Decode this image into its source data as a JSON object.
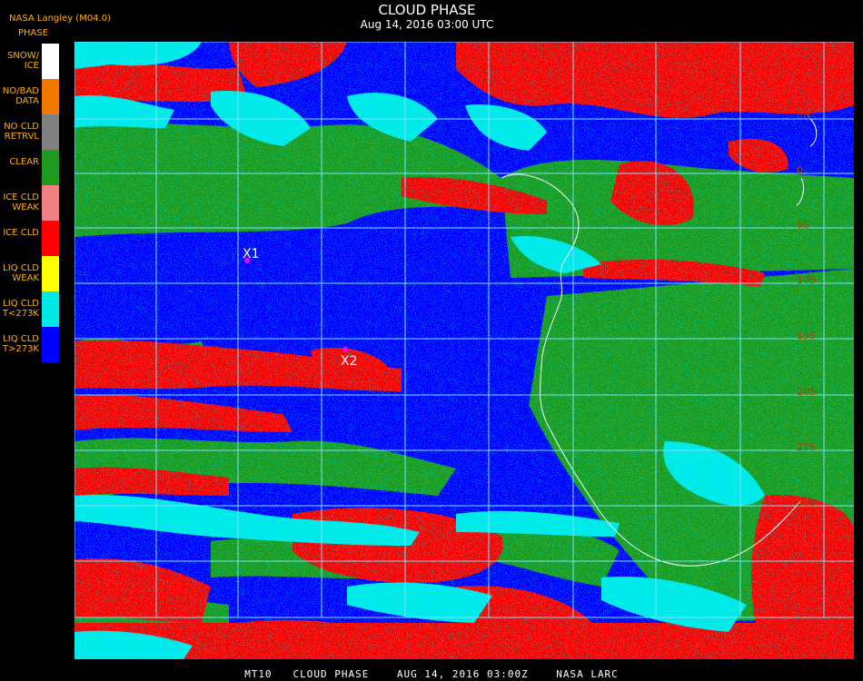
{
  "header": {
    "product": "NASA Langley (M04.0)",
    "phase_label": "PHASE",
    "title": "CLOUD PHASE",
    "datetime": "Aug 14, 2016 03:00 UTC"
  },
  "legend": [
    {
      "label": "SNOW/\nICE",
      "color": "#ffffff"
    },
    {
      "label": "NO/BAD\nDATA",
      "color": "#f07800"
    },
    {
      "label": "NO CLD\nRETRVL",
      "color": "#808080"
    },
    {
      "label": "CLEAR",
      "color": "#1e9a1e"
    },
    {
      "label": "ICE CLD\nWEAK",
      "color": "#f08080"
    },
    {
      "label": "ICE CLD",
      "color": "#ff0000"
    },
    {
      "label": "LIQ CLD\nWEAK",
      "color": "#ffff00"
    },
    {
      "label": "LIQ CLD\nT<273K",
      "color": "#00e8e8"
    },
    {
      "label": "LIQ CLD\nT>273K",
      "color": "#0000ff"
    }
  ],
  "map": {
    "grid_color": "#7fe0ff",
    "coast_color": "#ffffff",
    "lat_label_color": "#b04000",
    "lat_labels": [
      "5N",
      "0",
      "5S",
      "10S",
      "15S",
      "20S",
      "25S",
      "30S"
    ],
    "markers": [
      {
        "label": "X1",
        "color": "#ff00ff"
      },
      {
        "label": "X2",
        "color": "#ff00ff"
      }
    ]
  },
  "footer": "MT10   CLOUD PHASE    AUG 14, 2016 03:00Z    NASA LARC"
}
